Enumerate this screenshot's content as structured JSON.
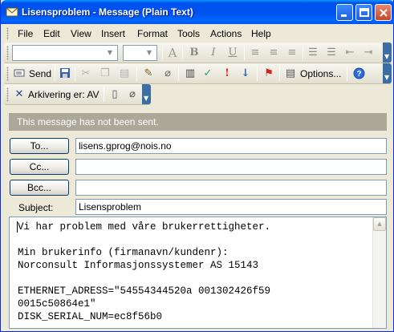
{
  "window": {
    "title": "Lisensproblem - Message (Plain Text)"
  },
  "menu": {
    "items": [
      "File",
      "Edit",
      "View",
      "Insert",
      "Format",
      "Tools",
      "Actions",
      "Help"
    ]
  },
  "toolbar_standard": {
    "send_label": "Send",
    "options_label": "Options..."
  },
  "toolbar_archive": {
    "label": "Arkivering er: AV"
  },
  "infobar": {
    "text": "This message has not been sent."
  },
  "address": {
    "to_button": "To...",
    "to_value": "lisens.gprog@nois.no",
    "cc_button": "Cc...",
    "cc_value": "",
    "bcc_button": "Bcc...",
    "bcc_value": "",
    "subject_label": "Subject:",
    "subject_value": "Lisensproblem"
  },
  "body": {
    "lines": [
      "Vi har problem med våre brukerrettigheter.",
      "",
      "Min brukerinfo (firmanavn/kundenr):",
      "Norconsult Informasjonssystemer AS 15143",
      "",
      "ETHERNET_ADRESS=\"54554344520a 001302426f59",
      "0015c50864e1\"",
      "DISK_SERIAL_NUM=ec8f56b0"
    ]
  },
  "colors": {
    "titlebar": "#0054E3",
    "infobar": "#ACA899",
    "face": "#ECE9D8"
  }
}
